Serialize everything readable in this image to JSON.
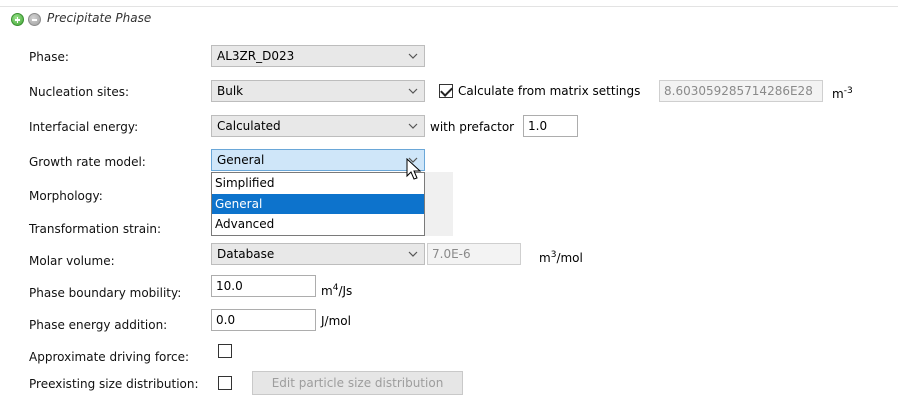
{
  "group": {
    "title": "Precipitate Phase"
  },
  "rows": {
    "phase": {
      "label": "Phase:",
      "value": "AL3ZR_D023"
    },
    "nucleation": {
      "label": "Nucleation sites:",
      "value": "Bulk",
      "checkbox_label": "Calculate from matrix settings",
      "checked": true,
      "field_value": "8.603059285714286E28",
      "unit_base": "m",
      "unit_sup": "-3"
    },
    "interfacial": {
      "label": "Interfacial energy:",
      "value": "Calculated",
      "prefactor_label": "with prefactor",
      "prefactor_value": "1.0"
    },
    "growth": {
      "label": "Growth rate model:",
      "value": "General",
      "options": [
        "Simplified",
        "General",
        "Advanced"
      ],
      "selected_index": 1
    },
    "morphology": {
      "label": "Morphology:"
    },
    "strain": {
      "label": "Transformation strain:"
    },
    "molar": {
      "label": "Molar volume:",
      "value": "Database",
      "field_value": "7.0E-6",
      "unit_base": "m",
      "unit_sup": "3",
      "unit_tail": "/mol"
    },
    "mobility": {
      "label": "Phase boundary mobility:",
      "value": "10.0",
      "unit_base": "m",
      "unit_sup": "4",
      "unit_tail": "/Js"
    },
    "energy": {
      "label": "Phase energy addition:",
      "value": "0.0",
      "unit": "J/mol"
    },
    "driving": {
      "label": "Approximate driving force:",
      "checked": false
    },
    "preexisting": {
      "label": "Preexisting size distribution:",
      "checked": false,
      "button_label": "Edit particle size distribution"
    }
  },
  "icons": [
    "add-circle-icon",
    "remove-circle-icon",
    "chevron-down-icon",
    "mouse-cursor-icon"
  ],
  "colors": {
    "selection": "#0d73cc",
    "combo_open": "#cfe6f9",
    "add_green": "#3fa535"
  }
}
